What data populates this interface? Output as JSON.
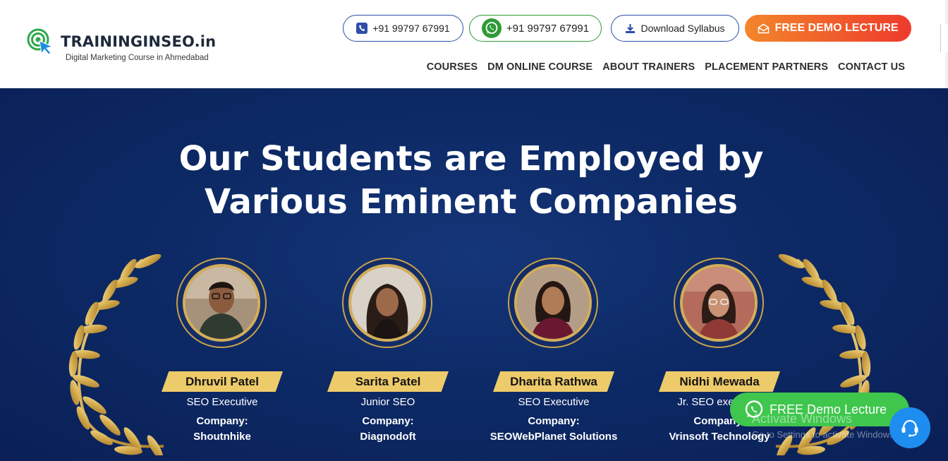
{
  "header": {
    "logo": {
      "title": "TRAININGINSEO.in",
      "subtitle": "Digital Marketing Course in Ahmedabad"
    },
    "contact_buttons": {
      "phone_label": "+91 99797 67991",
      "whatsapp_label": "+91 99797 67991",
      "download_label": "Download Syllabus",
      "demo_label": "FREE DEMO LECTURE"
    },
    "nav": [
      "COURSES",
      "DM ONLINE COURSE",
      "ABOUT TRAINERS",
      "PLACEMENT PARTNERS",
      "CONTACT US"
    ]
  },
  "hero": {
    "title_line1": "Our Students are Employed by",
    "title_line2": "Various Eminent Companies"
  },
  "students": [
    {
      "name": "Dhruvil Patel",
      "role": "SEO Executive",
      "company_label": "Company:",
      "company": "Shoutnhike"
    },
    {
      "name": "Sarita Patel",
      "role": "Junior SEO",
      "company_label": "Company:",
      "company": "Diagnodoft"
    },
    {
      "name": "Dharita Rathwa",
      "role": "SEO Executive",
      "company_label": "Company:",
      "company": "SEOWebPlanet Solutions"
    },
    {
      "name": "Nidhi Mewada",
      "role": "Jr. SEO executive",
      "company_label": "Company:",
      "company": "Vrinsoft Technology"
    }
  ],
  "floating": {
    "demo_label": "FREE Demo Lecture",
    "watermark_title": "Activate Windows",
    "watermark_sub": "Go to Settings to activate Windows."
  },
  "colors": {
    "navy": "#0d2a66",
    "gold": "#eecb6a",
    "orange_gradient_start": "#f3862a",
    "orange_gradient_end": "#ee3a2d",
    "whatsapp_green": "#3fc64d",
    "chat_blue": "#1e8df0"
  },
  "icons": [
    "target-cursor-logo-icon",
    "phone-icon",
    "whatsapp-icon",
    "download-icon",
    "envelope-icon",
    "laurel-icon",
    "chat-support-icon"
  ]
}
